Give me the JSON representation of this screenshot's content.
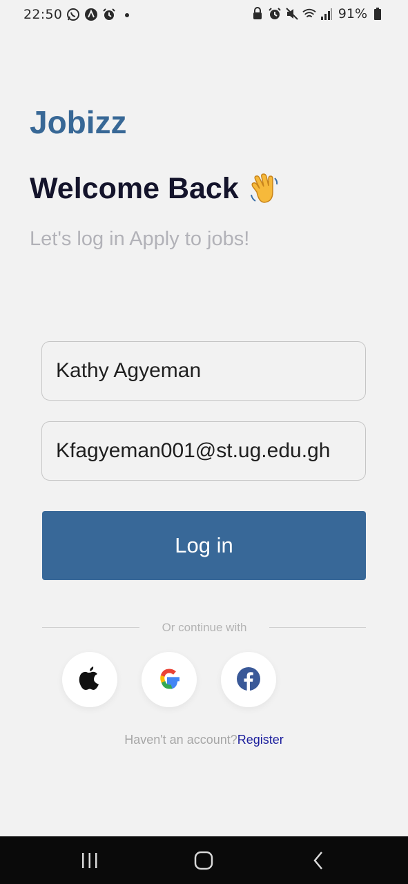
{
  "status_bar": {
    "time": "22:50",
    "left_icons": [
      "whatsapp-icon",
      "app-notification-icon",
      "alarm-icon",
      "dot-icon"
    ],
    "right_icons": [
      "lock-icon",
      "alarm-icon",
      "mute-icon",
      "wifi-icon",
      "signal-icon"
    ],
    "battery": "91%"
  },
  "header": {
    "brand": "Jobizz",
    "welcome": "Welcome Back",
    "welcome_icon": "waving-hand-icon",
    "subtitle": "Let's log in Apply to jobs!"
  },
  "form": {
    "name_value": "Kathy Agyeman",
    "email_value": "Kfagyeman001@st.ug.edu.gh",
    "login_label": "Log in"
  },
  "social": {
    "divider_text": "Or continue with",
    "providers": [
      "apple-icon",
      "google-icon",
      "facebook-icon"
    ]
  },
  "register": {
    "prompt": "Haven't an account?",
    "link": "Register"
  },
  "colors": {
    "brand": "#386896",
    "button": "#386898",
    "link": "#1a1d9c",
    "background": "#f2f2f2"
  }
}
